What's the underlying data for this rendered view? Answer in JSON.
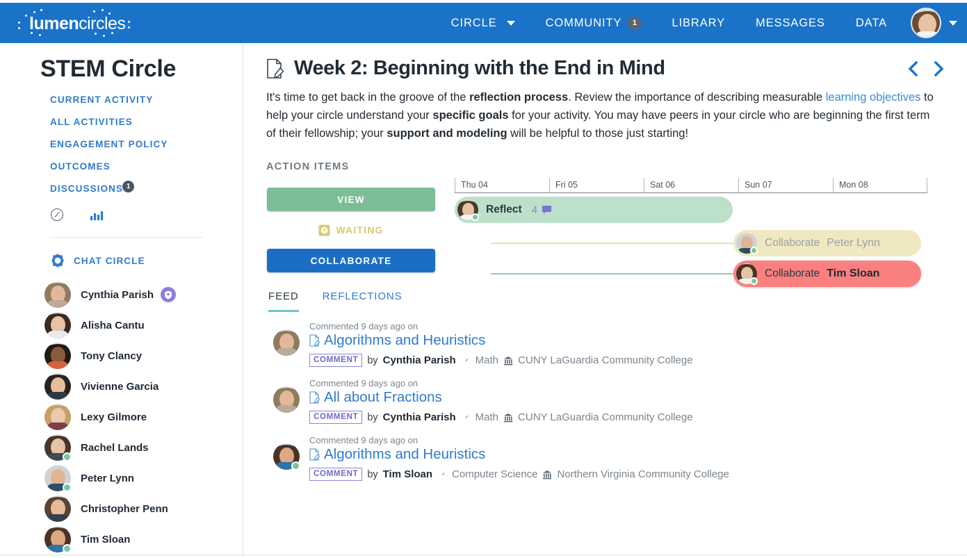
{
  "brand": {
    "logo_primary": "lumen",
    "logo_secondary": "circles",
    "nav_bg": "#1a73c8",
    "link_blue": "#2f7bcc"
  },
  "topnav": {
    "items": [
      {
        "label": "CIRCLE",
        "has_caret": true,
        "badge": null
      },
      {
        "label": "COMMUNITY",
        "has_caret": false,
        "badge": "1"
      },
      {
        "label": "LIBRARY",
        "has_caret": false,
        "badge": null
      },
      {
        "label": "MESSAGES",
        "has_caret": false,
        "badge": null
      },
      {
        "label": "DATA",
        "has_caret": false,
        "badge": null
      }
    ]
  },
  "sidebar": {
    "title": "STEM Circle",
    "links": [
      {
        "label": "CURRENT ACTIVITY",
        "badge": null
      },
      {
        "label": "ALL ACTIVITIES",
        "badge": null
      },
      {
        "label": "ENGAGEMENT POLICY",
        "badge": null
      },
      {
        "label": "OUTCOMES",
        "badge": null
      },
      {
        "label": "DISCUSSIONS",
        "badge": "1"
      }
    ],
    "icons": [
      {
        "name": "compass-icon"
      },
      {
        "name": "bar-chart-icon"
      }
    ],
    "chat_circle_label": "CHAT CIRCLE",
    "members": [
      {
        "name": "Cynthia Parish",
        "online": false,
        "shield": true,
        "skin": "#e3b79a",
        "hair": "#8f7b5e",
        "shirt": "#b9aa9c"
      },
      {
        "name": "Alisha Cantu",
        "online": false,
        "shield": false,
        "skin": "#e8c3a5",
        "hair": "#3a2b22",
        "shirt": "#e8eaec"
      },
      {
        "name": "Tony Clancy",
        "online": false,
        "shield": false,
        "skin": "#8a5a3c",
        "hair": "#241a14",
        "shirt": "#d9603c"
      },
      {
        "name": "Vivienne Garcia",
        "online": false,
        "shield": false,
        "skin": "#e6bd9c",
        "hair": "#2a2220",
        "shirt": "#2f3a46"
      },
      {
        "name": "Lexy Gilmore",
        "online": false,
        "shield": false,
        "skin": "#ecc8ad",
        "hair": "#c9a063",
        "shirt": "#7d3f50"
      },
      {
        "name": "Rachel Lands",
        "online": true,
        "shield": false,
        "skin": "#e8c2a4",
        "hair": "#4a3528",
        "shirt": "#3d4a57"
      },
      {
        "name": "Peter Lynn",
        "online": true,
        "shield": false,
        "skin": "#e0b493",
        "hair": "#cfd3d6",
        "shirt": "#2e4d66"
      },
      {
        "name": "Christopher Penn",
        "online": false,
        "shield": false,
        "skin": "#e6bb9a",
        "hair": "#5a4332",
        "shirt": "#35404c"
      },
      {
        "name": "Tim Sloan",
        "online": true,
        "shield": false,
        "skin": "#dda882",
        "hair": "#4a3425",
        "shirt": "#2f73a8"
      }
    ]
  },
  "main": {
    "page_title": "Week 2: Beginning with the End in Mind",
    "doc_icon": "document-edit-icon",
    "pager": {
      "prev": "chevron-left-icon",
      "next": "chevron-right-icon"
    },
    "intro": {
      "seg1": "It's time to get back in the groove of the ",
      "b1": "reflection process",
      "seg2": ". Review the importance of describing measurable ",
      "link1": "learning objectives",
      "seg3": " to help your circle understand your ",
      "b2": "specific goals",
      "seg4": " for your activity. You may have peers in your circle who are beginning the first term of their fellowship; your ",
      "b3": "support and modeling",
      "seg5": " will be helpful to those just starting!"
    },
    "action_items_label": "ACTION ITEMS",
    "buttons": {
      "view": "VIEW",
      "waiting": "WAITING",
      "collaborate": "COLLABORATE"
    },
    "timeline": {
      "days": [
        "Thu 04",
        "Fri 05",
        "Sat 06",
        "Sun 07",
        "Mon 08"
      ],
      "chips": [
        {
          "action": "Reflect",
          "person": "",
          "count": "4",
          "bubble": "comment-bubble-icon",
          "color": "#bce0c9"
        },
        {
          "action": "Collaborate",
          "person": "Peter Lynn",
          "count": null,
          "bubble": null,
          "color": "#f0e8c0"
        },
        {
          "action": "Collaborate",
          "person": "Tim Sloan",
          "count": null,
          "bubble": null,
          "color": "#f9807f"
        }
      ]
    },
    "tabs": [
      {
        "label": "FEED",
        "active": true
      },
      {
        "label": "REFLECTIONS",
        "active": false
      }
    ],
    "feed": [
      {
        "time": "Commented 9 days ago on",
        "title": "Algorithms and Heuristics",
        "tag": "COMMENT",
        "by": "by",
        "author": "Cynthia Parish",
        "subject": "Math",
        "institution": "CUNY LaGuardia Community College",
        "avatar": {
          "skin": "#e3b79a",
          "hair": "#8f7b5e",
          "shirt": "#b9aa9c",
          "online": false
        }
      },
      {
        "time": "Commented 9 days ago on",
        "title": "All about Fractions",
        "tag": "COMMENT",
        "by": "by",
        "author": "Cynthia Parish",
        "subject": "Math",
        "institution": "CUNY LaGuardia Community College",
        "avatar": {
          "skin": "#e3b79a",
          "hair": "#8f7b5e",
          "shirt": "#b9aa9c",
          "online": false
        }
      },
      {
        "time": "Commented 9 days ago on",
        "title": "Algorithms and Heuristics",
        "tag": "COMMENT",
        "by": "by",
        "author": "Tim Sloan",
        "subject": "Computer Science",
        "institution": "Northern Virginia Community College",
        "avatar": {
          "skin": "#dda882",
          "hair": "#4a3425",
          "shirt": "#2f73a8",
          "online": true
        }
      }
    ]
  }
}
